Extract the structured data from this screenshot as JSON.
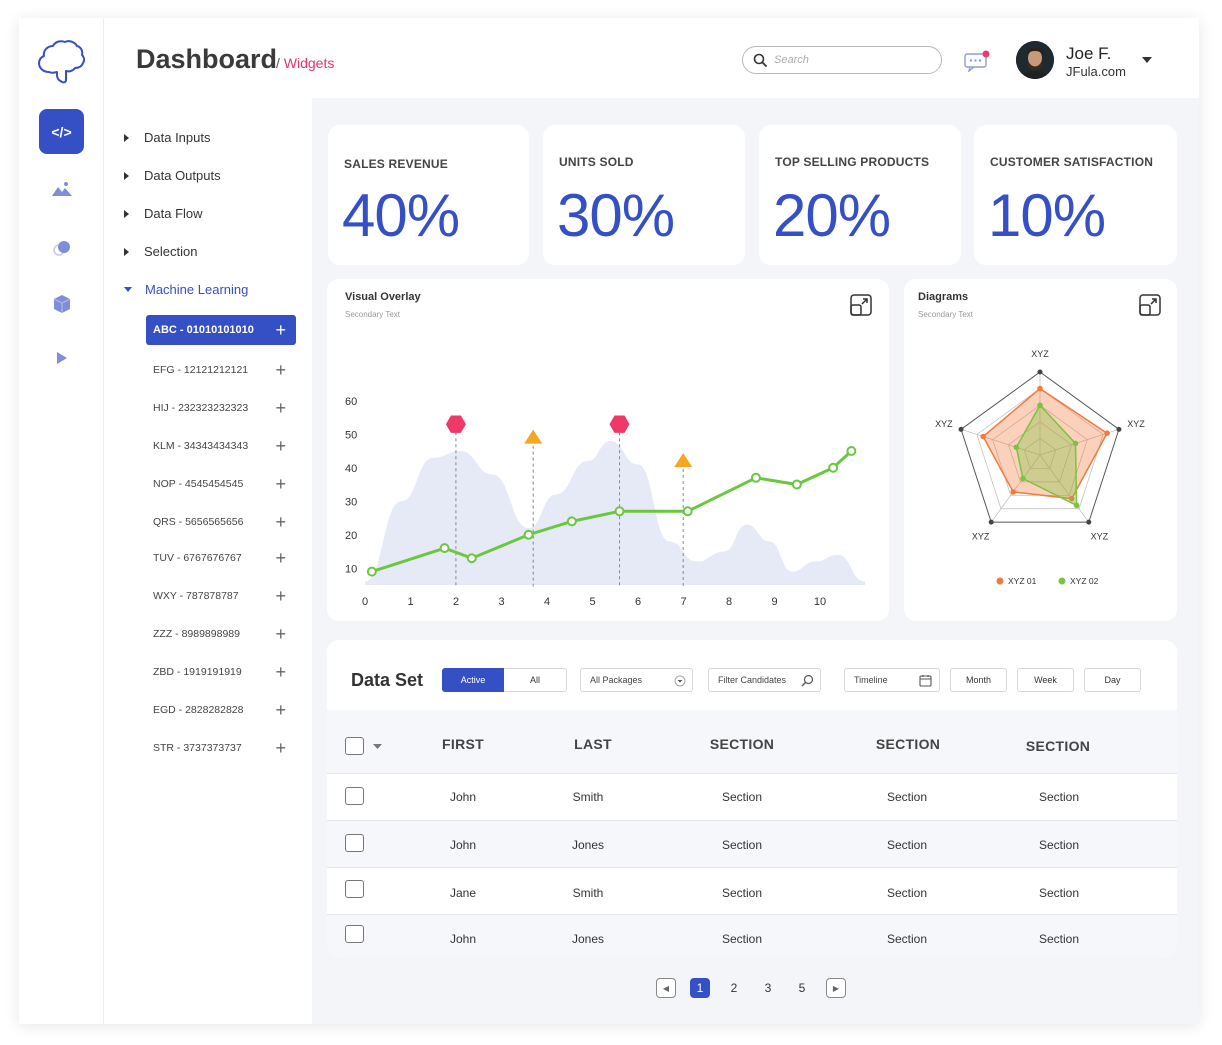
{
  "header": {
    "title": "Dashboard",
    "breadcrumb_sep": "/",
    "breadcrumb": "Widgets",
    "search_placeholder": "Search",
    "user_name": "Joe F.",
    "user_domain": "JFula.com"
  },
  "rail": {
    "active_label": "</>"
  },
  "tree": {
    "items": [
      "Data Inputs",
      "Data Outputs",
      "Data Flow",
      "Selection",
      "Machine Learning"
    ],
    "sub_items": [
      "ABC - 01010101010",
      "EFG - 12121212121",
      "HIJ - 232323232323",
      "KLM - 34343434343",
      "NOP - 4545454545",
      "QRS - 5656565656",
      "TUV - 6767676767",
      "WXY - 787878787",
      "ZZZ - 8989898989",
      "ZBD - 1919191919",
      "EGD - 2828282828",
      "STR - 3737373737"
    ]
  },
  "kpis": [
    {
      "label": "SALES REVENUE",
      "value": "40%"
    },
    {
      "label": "UNITS SOLD",
      "value": "30%"
    },
    {
      "label": "TOP SELLING PRODUCTS",
      "value": "20%"
    },
    {
      "label": "CUSTOMER SATISFACTION",
      "value": "10%"
    }
  ],
  "chart_data": [
    {
      "type": "line",
      "title": "Visual Overlay",
      "subtitle": "Secondary Text",
      "x_ticks": [
        "0",
        "1",
        "2",
        "3",
        "4",
        "5",
        "6",
        "7",
        "8",
        "9",
        "10"
      ],
      "y_ticks": [
        "10",
        "20",
        "30",
        "40",
        "50",
        "60"
      ],
      "xlim": [
        0,
        11
      ],
      "ylim": [
        5,
        65
      ],
      "series": [
        {
          "values": [
            [
              0.15,
              9
            ],
            [
              1.75,
              16
            ],
            [
              2.35,
              13
            ],
            [
              3.6,
              20
            ],
            [
              4.55,
              24
            ],
            [
              5.6,
              27
            ],
            [
              7.1,
              27
            ],
            [
              8.6,
              37
            ],
            [
              9.5,
              35
            ],
            [
              10.3,
              40
            ],
            [
              10.7,
              45
            ]
          ]
        }
      ],
      "area": {
        "values": [
          [
            0,
            6
          ],
          [
            0.8,
            30
          ],
          [
            1.5,
            43
          ],
          [
            2.1,
            45
          ],
          [
            2.8,
            38
          ],
          [
            3.6,
            22
          ],
          [
            4.2,
            32
          ],
          [
            4.9,
            42
          ],
          [
            5.4,
            48
          ],
          [
            6.0,
            41
          ],
          [
            6.7,
            18
          ],
          [
            7.3,
            12
          ],
          [
            7.9,
            15
          ],
          [
            8.4,
            23
          ],
          [
            8.9,
            18
          ],
          [
            9.4,
            9
          ],
          [
            9.9,
            12
          ],
          [
            10.4,
            14
          ],
          [
            11,
            6
          ]
        ]
      },
      "markers": [
        {
          "x": 2.0,
          "y": 53,
          "shape": "hexagon",
          "color": "#ee3968"
        },
        {
          "x": 3.7,
          "y": 49,
          "shape": "triangle",
          "color": "#f5a623"
        },
        {
          "x": 5.6,
          "y": 53,
          "shape": "hexagon",
          "color": "#ee3968"
        },
        {
          "x": 7.0,
          "y": 42,
          "shape": "triangle",
          "color": "#f5a623"
        }
      ],
      "colors": {
        "line": "#6ac840",
        "area": "#e6eaf6"
      }
    },
    {
      "type": "radar",
      "title": "Diagrams",
      "subtitle": "Secondary Text",
      "axes": [
        "XYZ",
        "XYZ",
        "XYZ",
        "XYZ",
        "XYZ"
      ],
      "series": [
        {
          "name": "XYZ 01",
          "color": "#f47a3c",
          "values": [
            0.8,
            0.85,
            0.65,
            0.55,
            0.72
          ]
        },
        {
          "name": "XYZ 02",
          "color": "#7dc242",
          "values": [
            0.6,
            0.45,
            0.75,
            0.35,
            0.3
          ]
        }
      ]
    }
  ],
  "dataset": {
    "title": "Data Set",
    "seg_active": "Active",
    "seg_all": "All",
    "packages": "All Packages",
    "filter": "Filter Candidates",
    "timeline": "Timeline",
    "month": "Month",
    "week": "Week",
    "day": "Day",
    "headers": [
      "FIRST",
      "LAST",
      "SECTION",
      "SECTION",
      "SECTION"
    ],
    "rows": [
      [
        "John",
        "Smith",
        "Section",
        "Section",
        "Section"
      ],
      [
        "John",
        "Jones",
        "Section",
        "Section",
        "Section"
      ],
      [
        "Jane",
        "Smith",
        "Section",
        "Section",
        "Section"
      ],
      [
        "John",
        "Jones",
        "Section",
        "Section",
        "Section"
      ]
    ]
  },
  "pagination": {
    "pages": [
      "1",
      "2",
      "3",
      "5"
    ],
    "current": 1
  }
}
